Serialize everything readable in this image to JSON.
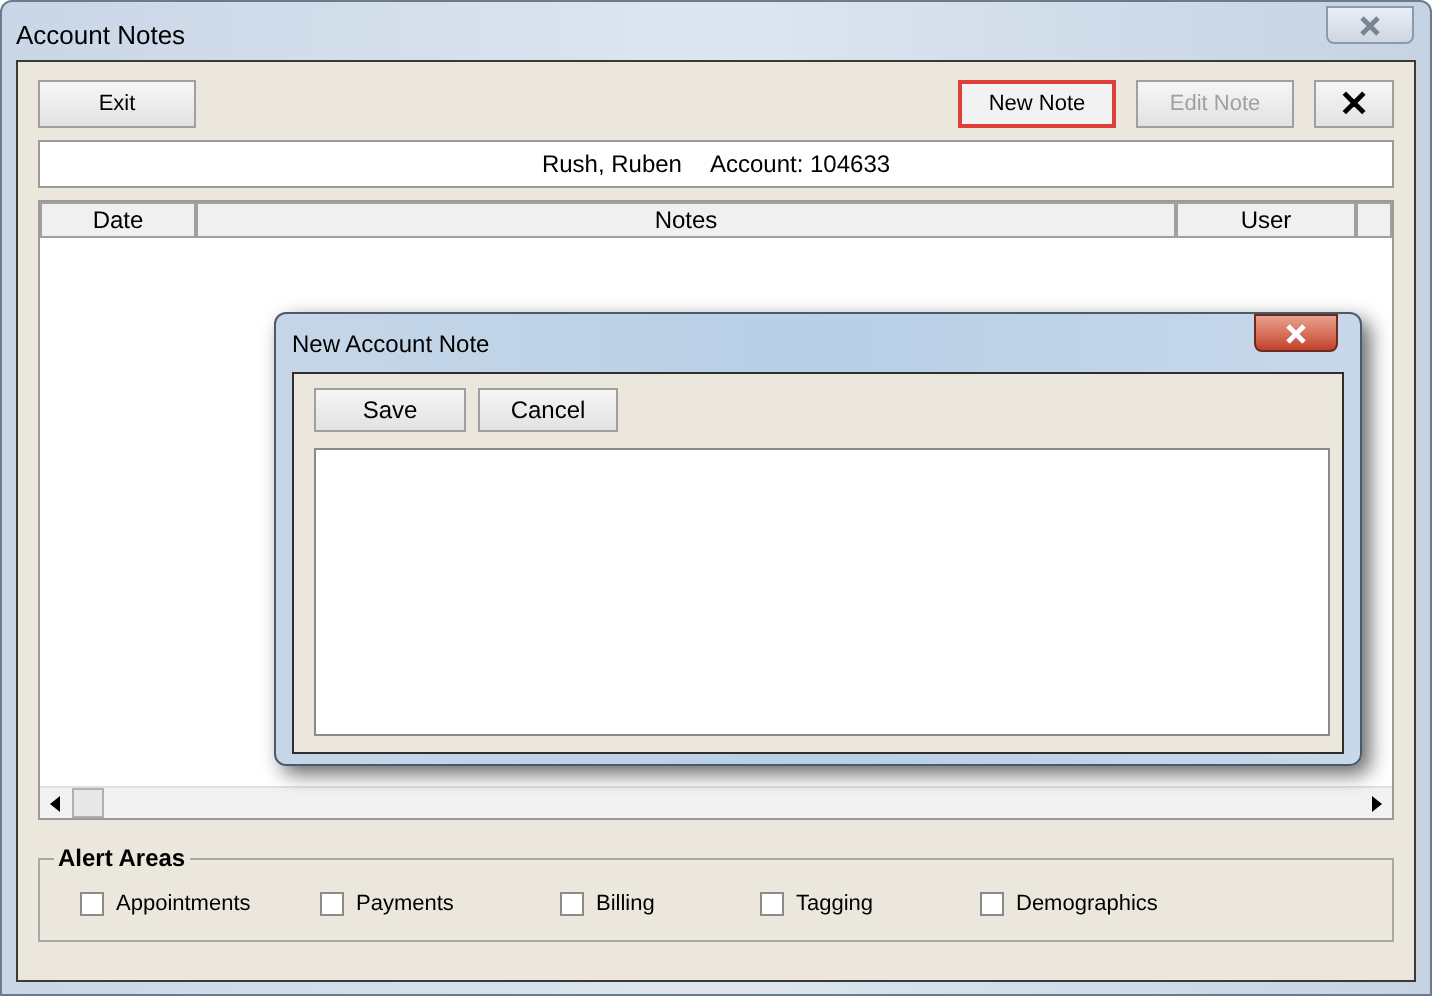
{
  "window": {
    "title": "Account Notes"
  },
  "toolbar": {
    "buttons": [
      {
        "kind": "text",
        "label": "Exit",
        "disabled": false,
        "highlighted": false
      },
      {
        "kind": "text",
        "label": "New Note",
        "disabled": false,
        "highlighted": true
      },
      {
        "kind": "text",
        "label": "Edit Note",
        "disabled": true,
        "highlighted": false
      },
      {
        "kind": "close",
        "label": "✕",
        "disabled": false,
        "highlighted": false
      }
    ]
  },
  "account_bar": {
    "name": "Rush, Ruben",
    "account": "Account: 104633"
  },
  "table": {
    "columns": [
      "Date",
      "Notes",
      "User"
    ]
  },
  "alert_areas": {
    "title": "Alert Areas",
    "items": [
      {
        "label": "Appointments",
        "checked": false
      },
      {
        "label": "Payments",
        "checked": false
      },
      {
        "label": "Billing",
        "checked": false
      },
      {
        "label": "Tagging",
        "checked": false
      },
      {
        "label": "Demographics",
        "checked": false
      }
    ]
  },
  "dialog": {
    "title": "New Account Note",
    "buttons": [
      "Save",
      "Cancel"
    ]
  }
}
